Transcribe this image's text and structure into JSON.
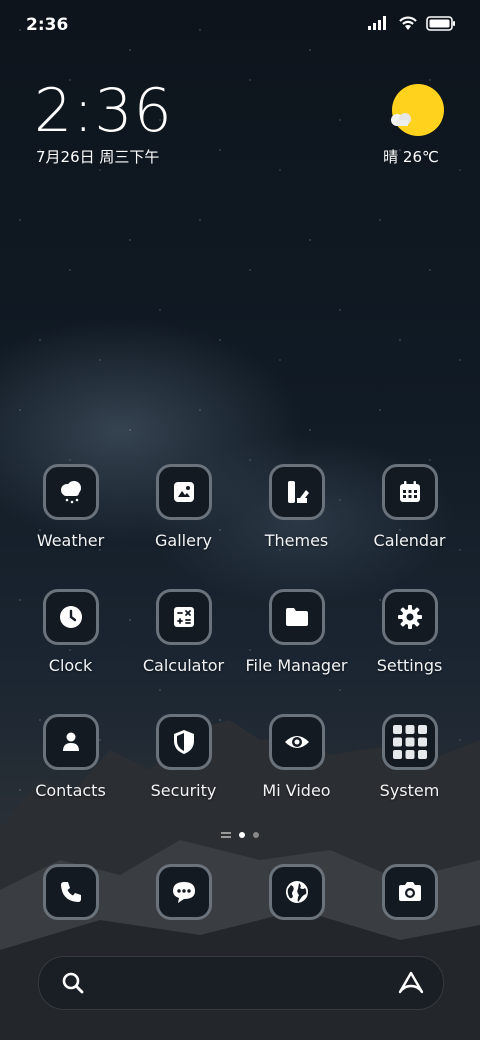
{
  "status_bar": {
    "time": "2:36",
    "icons": [
      "signal-icon",
      "wifi-icon",
      "battery-icon"
    ]
  },
  "clock_widget": {
    "time": "2:36",
    "date": "7月26日 周三下午"
  },
  "weather_widget": {
    "condition_icon": "sunny-partly-cloudy-icon",
    "text": "晴 26℃",
    "sun_color": "#ffd21e"
  },
  "apps": [
    {
      "label": "Weather",
      "icon": "weather-icon"
    },
    {
      "label": "Gallery",
      "icon": "gallery-icon"
    },
    {
      "label": "Themes",
      "icon": "themes-icon"
    },
    {
      "label": "Calendar",
      "icon": "calendar-icon"
    },
    {
      "label": "Clock",
      "icon": "clock-icon"
    },
    {
      "label": "Calculator",
      "icon": "calculator-icon"
    },
    {
      "label": "File Manager",
      "icon": "folder-icon"
    },
    {
      "label": "Settings",
      "icon": "gear-icon"
    },
    {
      "label": "Contacts",
      "icon": "contacts-icon"
    },
    {
      "label": "Security",
      "icon": "shield-icon"
    },
    {
      "label": "Mi Video",
      "icon": "eye-icon"
    },
    {
      "label": "System",
      "icon": "system-folder-icon"
    }
  ],
  "pager": {
    "pages": 2,
    "current": 1
  },
  "dock": [
    {
      "icon": "phone-icon"
    },
    {
      "icon": "messages-icon"
    },
    {
      "icon": "browser-globe-icon"
    },
    {
      "icon": "camera-icon"
    }
  ],
  "search_bar": {
    "left_icon": "search-icon",
    "right_icon": "assistant-icon"
  },
  "colors": {
    "icon_background": "#141a22",
    "icon_border": "#6a727b"
  }
}
